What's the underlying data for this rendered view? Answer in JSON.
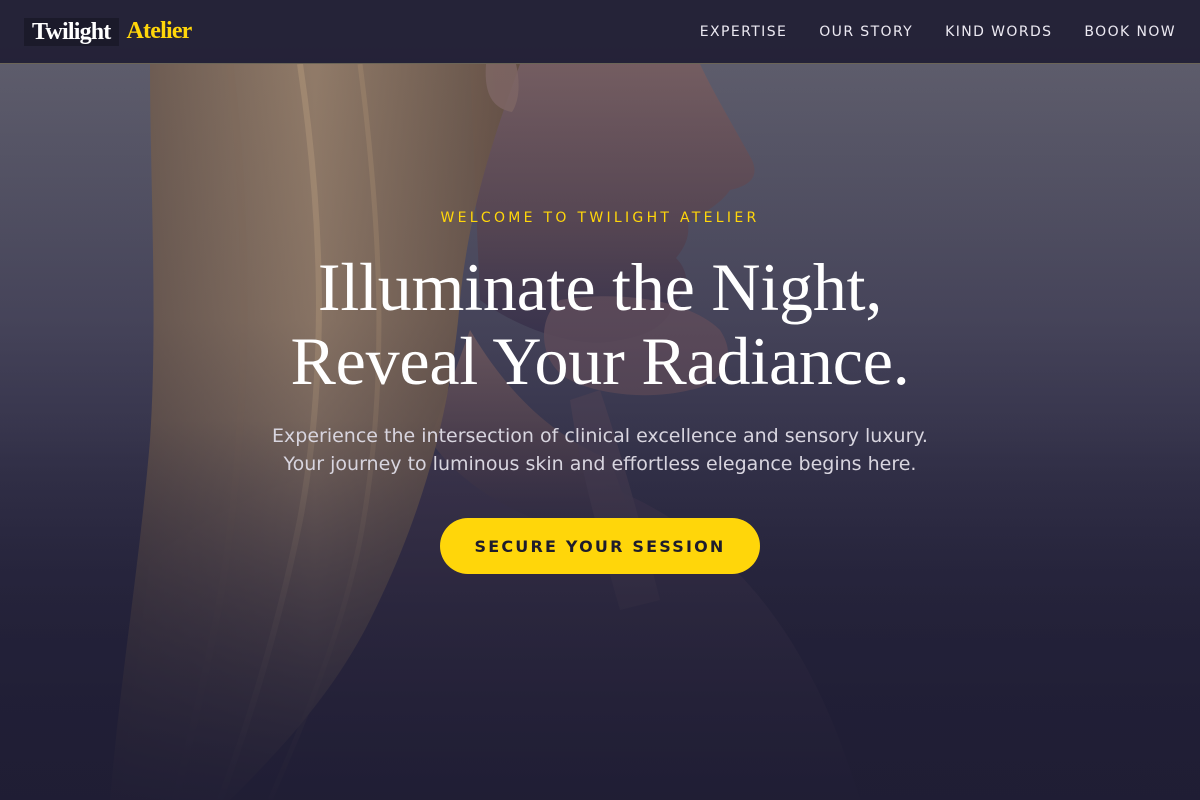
{
  "header": {
    "logo": {
      "primary": "Twilight",
      "accent": "Atelier"
    },
    "nav": {
      "items": [
        {
          "label": "EXPERTISE"
        },
        {
          "label": "OUR STORY"
        },
        {
          "label": "KIND WORDS"
        },
        {
          "label": "BOOK NOW"
        }
      ]
    }
  },
  "hero": {
    "eyebrow": "WELCOME TO TWILIGHT ATELIER",
    "headline": {
      "line1": "Illuminate the Night,",
      "line2": "Reveal Your Radiance."
    },
    "subtext": "Experience the intersection of clinical excellence and sensory luxury. Your journey to luminous skin and effortless elegance begins here.",
    "cta_label": "SECURE YOUR SESSION"
  },
  "colors": {
    "accent": "#ffd60a",
    "header_bg": "#222036",
    "hero_overlay": "#2e2c46",
    "text_light": "#ffffff"
  }
}
